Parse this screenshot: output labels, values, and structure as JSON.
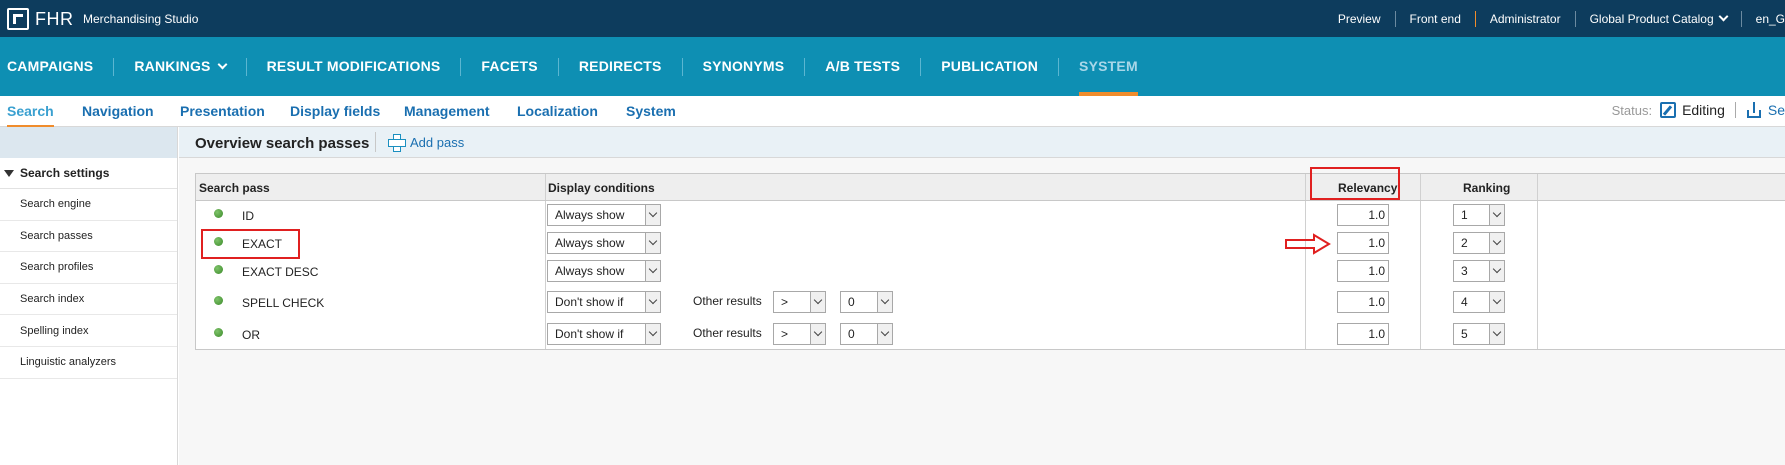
{
  "topbar": {
    "brand": "FHR",
    "app_name": "Merchandising Studio",
    "links": [
      "Preview",
      "Front end",
      "Administrator",
      "Global Product Catalog",
      "en_G"
    ]
  },
  "main_nav": [
    {
      "label": "CAMPAIGNS"
    },
    {
      "label": "RANKINGS"
    },
    {
      "label": "RESULT MODIFICATIONS"
    },
    {
      "label": "FACETS"
    },
    {
      "label": "REDIRECTS"
    },
    {
      "label": "SYNONYMS"
    },
    {
      "label": "A/B TESTS"
    },
    {
      "label": "PUBLICATION"
    },
    {
      "label": "SYSTEM"
    }
  ],
  "sub_nav": [
    "Search",
    "Navigation",
    "Presentation",
    "Display fields",
    "Management",
    "Localization",
    "System"
  ],
  "status": {
    "label": "Status:",
    "value": "Editing",
    "publish_partial": "Se"
  },
  "sidebar": {
    "section": "Search settings",
    "items": [
      "Search engine",
      "Search passes",
      "Search profiles",
      "Search index",
      "Spelling index",
      "Linguistic analyzers"
    ]
  },
  "content": {
    "title": "Overview search passes",
    "add_label": "Add pass",
    "columns": {
      "pass": "Search pass",
      "display": "Display conditions",
      "relevancy": "Relevancy",
      "ranking": "Ranking"
    },
    "rows": [
      {
        "name": "ID",
        "condition": "Always show",
        "relevancy": "1.0",
        "ranking": "1"
      },
      {
        "name": "EXACT",
        "condition": "Always show",
        "relevancy": "1.0",
        "ranking": "2"
      },
      {
        "name": "EXACT DESC",
        "condition": "Always show",
        "relevancy": "1.0",
        "ranking": "3"
      },
      {
        "name": "SPELL CHECK",
        "condition": "Don't show if",
        "other_label": "Other results",
        "operator": ">",
        "threshold": "0",
        "relevancy": "1.0",
        "ranking": "4"
      },
      {
        "name": "OR",
        "condition": "Don't show if",
        "other_label": "Other results",
        "operator": ">",
        "threshold": "0",
        "relevancy": "1.0",
        "ranking": "5"
      }
    ]
  },
  "colors": {
    "topbar": "#0d3c5d",
    "nav": "#0e8fb3",
    "accent": "#f08c2c",
    "highlight": "#e02020",
    "status_dot": "#4a9b35"
  }
}
